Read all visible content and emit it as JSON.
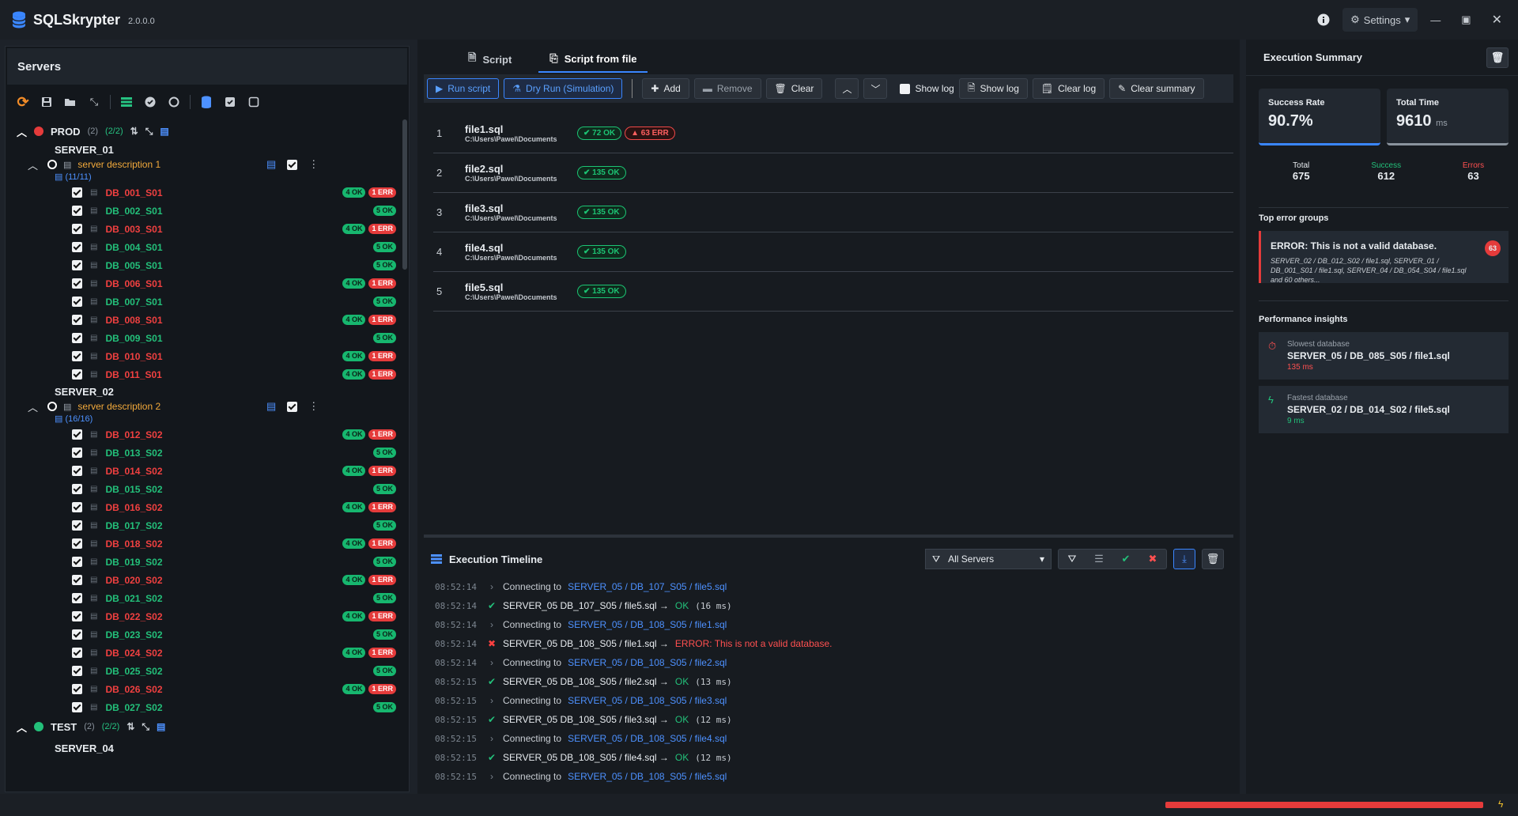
{
  "app": {
    "name": "SQLSkrypter",
    "version": "2.0.0.0",
    "settings_label": "Settings"
  },
  "servers_panel": {
    "title": "Servers",
    "environments": [
      {
        "name": "PROD",
        "count": "(2)",
        "enabled": "(2/2)",
        "color": "#e53b3b",
        "servers": [
          {
            "name": "SERVER_01",
            "description": "server description 1",
            "db_count": "(11/11)",
            "databases": [
              {
                "name": "DB_001_S01",
                "status": "err",
                "ok": "4 OK",
                "err": "1 ERR"
              },
              {
                "name": "DB_002_S01",
                "status": "ok",
                "ok": "5 OK"
              },
              {
                "name": "DB_003_S01",
                "status": "err",
                "ok": "4 OK",
                "err": "1 ERR"
              },
              {
                "name": "DB_004_S01",
                "status": "ok",
                "ok": "5 OK"
              },
              {
                "name": "DB_005_S01",
                "status": "ok",
                "ok": "5 OK"
              },
              {
                "name": "DB_006_S01",
                "status": "err",
                "ok": "4 OK",
                "err": "1 ERR"
              },
              {
                "name": "DB_007_S01",
                "status": "ok",
                "ok": "5 OK"
              },
              {
                "name": "DB_008_S01",
                "status": "err",
                "ok": "4 OK",
                "err": "1 ERR"
              },
              {
                "name": "DB_009_S01",
                "status": "ok",
                "ok": "5 OK"
              },
              {
                "name": "DB_010_S01",
                "status": "err",
                "ok": "4 OK",
                "err": "1 ERR"
              },
              {
                "name": "DB_011_S01",
                "status": "err",
                "ok": "4 OK",
                "err": "1 ERR"
              }
            ]
          },
          {
            "name": "SERVER_02",
            "description": "server description 2",
            "db_count": "(16/16)",
            "databases": [
              {
                "name": "DB_012_S02",
                "status": "err",
                "ok": "4 OK",
                "err": "1 ERR"
              },
              {
                "name": "DB_013_S02",
                "status": "ok",
                "ok": "5 OK"
              },
              {
                "name": "DB_014_S02",
                "status": "err",
                "ok": "4 OK",
                "err": "1 ERR"
              },
              {
                "name": "DB_015_S02",
                "status": "ok",
                "ok": "5 OK"
              },
              {
                "name": "DB_016_S02",
                "status": "err",
                "ok": "4 OK",
                "err": "1 ERR"
              },
              {
                "name": "DB_017_S02",
                "status": "ok",
                "ok": "5 OK"
              },
              {
                "name": "DB_018_S02",
                "status": "err",
                "ok": "4 OK",
                "err": "1 ERR"
              },
              {
                "name": "DB_019_S02",
                "status": "ok",
                "ok": "5 OK"
              },
              {
                "name": "DB_020_S02",
                "status": "err",
                "ok": "4 OK",
                "err": "1 ERR"
              },
              {
                "name": "DB_021_S02",
                "status": "ok",
                "ok": "5 OK"
              },
              {
                "name": "DB_022_S02",
                "status": "err",
                "ok": "4 OK",
                "err": "1 ERR"
              },
              {
                "name": "DB_023_S02",
                "status": "ok",
                "ok": "5 OK"
              },
              {
                "name": "DB_024_S02",
                "status": "err",
                "ok": "4 OK",
                "err": "1 ERR"
              },
              {
                "name": "DB_025_S02",
                "status": "ok",
                "ok": "5 OK"
              },
              {
                "name": "DB_026_S02",
                "status": "err",
                "ok": "4 OK",
                "err": "1 ERR"
              },
              {
                "name": "DB_027_S02",
                "status": "ok",
                "ok": "5 OK"
              }
            ]
          }
        ]
      },
      {
        "name": "TEST",
        "count": "(2)",
        "enabled": "(2/2)",
        "color": "#23c07a",
        "first_server": "SERVER_04"
      }
    ]
  },
  "tabs": [
    {
      "label": "Script"
    },
    {
      "label": "Script from file"
    }
  ],
  "actions": {
    "run": "Run script",
    "dry_run": "Dry Run (Simulation)",
    "add": "Add",
    "remove": "Remove",
    "clear": "Clear",
    "show_log_check": "Show log",
    "show_log": "Show log",
    "clear_log": "Clear log",
    "clear_summary": "Clear summary"
  },
  "files": [
    {
      "index": "1",
      "name": "file1.sql",
      "path": "C:\\Users\\Pawel\\Documents",
      "ok": "72 OK",
      "err": "63 ERR"
    },
    {
      "index": "2",
      "name": "file2.sql",
      "path": "C:\\Users\\Pawel\\Documents",
      "ok": "135 OK"
    },
    {
      "index": "3",
      "name": "file3.sql",
      "path": "C:\\Users\\Pawel\\Documents",
      "ok": "135 OK"
    },
    {
      "index": "4",
      "name": "file4.sql",
      "path": "C:\\Users\\Pawel\\Documents",
      "ok": "135 OK"
    },
    {
      "index": "5",
      "name": "file5.sql",
      "path": "C:\\Users\\Pawel\\Documents",
      "ok": "135 OK"
    }
  ],
  "timeline": {
    "title": "Execution Timeline",
    "filter_value": "All Servers",
    "entries": [
      {
        "time": "08:52:14",
        "type": "connect",
        "prefix": "Connecting to",
        "target": "SERVER_05 / DB_107_S05 / file5.sql"
      },
      {
        "time": "08:52:14",
        "type": "ok",
        "text": "SERVER_05 DB_107_S05 / file5.sql →",
        "result": "OK",
        "duration": "(16 ms)"
      },
      {
        "time": "08:52:14",
        "type": "connect",
        "prefix": "Connecting to",
        "target": "SERVER_05 / DB_108_S05 / file1.sql"
      },
      {
        "time": "08:52:14",
        "type": "err",
        "text": "SERVER_05 DB_108_S05 / file1.sql →",
        "result": "ERROR: This is not a valid database."
      },
      {
        "time": "08:52:14",
        "type": "connect",
        "prefix": "Connecting to",
        "target": "SERVER_05 / DB_108_S05 / file2.sql"
      },
      {
        "time": "08:52:15",
        "type": "ok",
        "text": "SERVER_05 DB_108_S05 / file2.sql →",
        "result": "OK",
        "duration": "(13 ms)"
      },
      {
        "time": "08:52:15",
        "type": "connect",
        "prefix": "Connecting to",
        "target": "SERVER_05 / DB_108_S05 / file3.sql"
      },
      {
        "time": "08:52:15",
        "type": "ok",
        "text": "SERVER_05 DB_108_S05 / file3.sql →",
        "result": "OK",
        "duration": "(12 ms)"
      },
      {
        "time": "08:52:15",
        "type": "connect",
        "prefix": "Connecting to",
        "target": "SERVER_05 / DB_108_S05 / file4.sql"
      },
      {
        "time": "08:52:15",
        "type": "ok",
        "text": "SERVER_05 DB_108_S05 / file4.sql →",
        "result": "OK",
        "duration": "(12 ms)"
      },
      {
        "time": "08:52:15",
        "type": "connect",
        "prefix": "Connecting to",
        "target": "SERVER_05 / DB_108_S05 / file5.sql"
      }
    ]
  },
  "summary": {
    "title": "Execution Summary",
    "success_rate_label": "Success Rate",
    "success_rate": "90.7%",
    "total_time_label": "Total Time",
    "total_time": "9610",
    "total_time_unit": "ms",
    "total_label": "Total",
    "total": "675",
    "success_label": "Success",
    "success": "612",
    "errors_label": "Errors",
    "errors": "63",
    "top_errors_title": "Top error groups",
    "error_group": {
      "title": "ERROR: This is not a valid database.",
      "detail": "SERVER_02 / DB_012_S02 / file1.sql, SERVER_01 / DB_001_S01 / file1.sql, SERVER_04 / DB_054_S04 / file1.sql and 60 others...",
      "count": "63"
    },
    "perf_title": "Performance insights",
    "slowest": {
      "label": "Slowest database",
      "name": "SERVER_05 / DB_085_S05 / file1.sql",
      "ms": "135 ms"
    },
    "fastest": {
      "label": "Fastest database",
      "name": "SERVER_02 / DB_014_S02 / file5.sql",
      "ms": "9 ms"
    }
  },
  "progress": 1.0
}
